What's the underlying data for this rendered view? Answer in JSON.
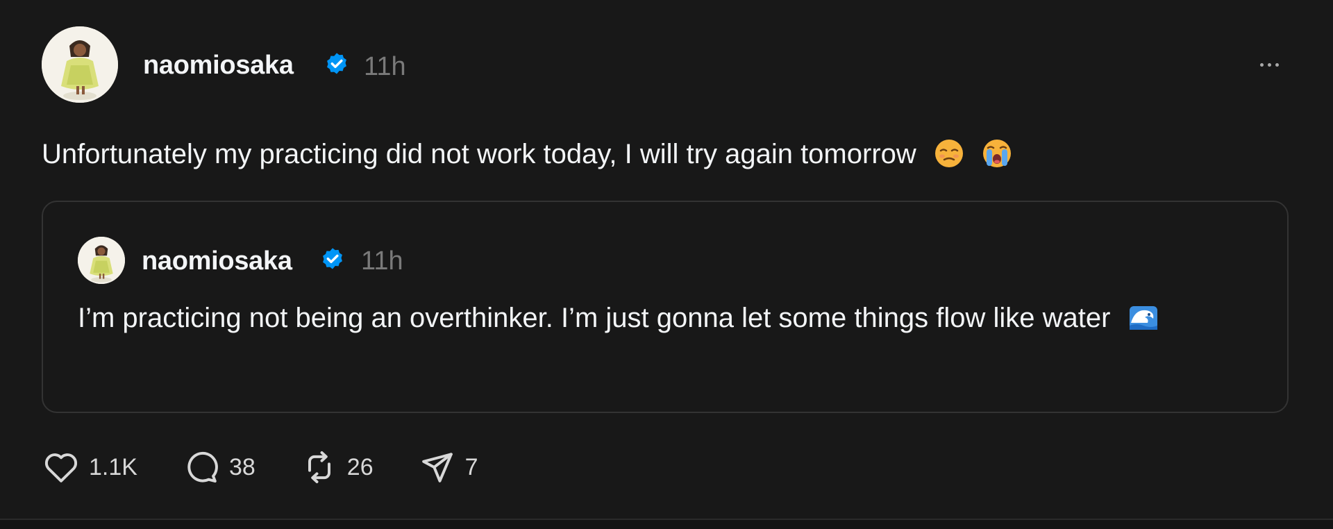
{
  "post": {
    "author": "naomiosaka",
    "time": "11h",
    "text": "Unfortunately my practicing did not work today, I will try again tomorrow",
    "emojis": [
      "pensive-face-emoji",
      "loudly-crying-face-emoji"
    ]
  },
  "quoted_post": {
    "author": "naomiosaka",
    "time": "11h",
    "text": "I’m practicing not being an overthinker. I’m just gonna let some things flow like water",
    "emojis": [
      "water-wave-emoji"
    ]
  },
  "actions": {
    "likes": "1.1K",
    "replies": "38",
    "reposts": "26",
    "shares": "7"
  },
  "colors": {
    "background": "#181818",
    "text": "#f3f5f7",
    "muted": "#7a7a7a",
    "verified": "#0095f6",
    "border": "#333333"
  },
  "icons": [
    "verified-badge-icon",
    "more-options-icon",
    "heart-icon",
    "comment-icon",
    "repost-icon",
    "share-icon"
  ]
}
